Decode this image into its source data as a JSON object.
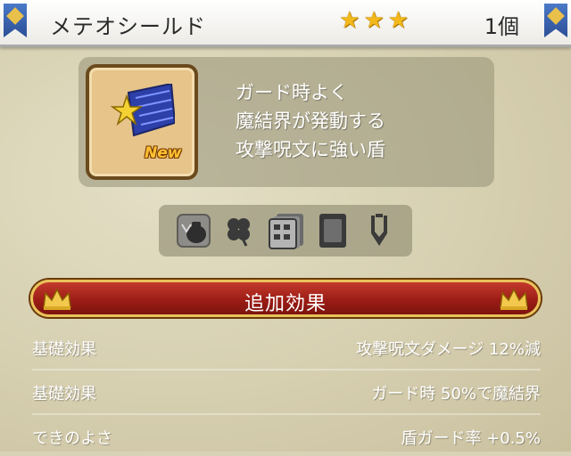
{
  "header": {
    "item_name": "メテオシールド",
    "rarity_stars": 3,
    "quantity": "1個"
  },
  "item": {
    "icon": "meteor-shield-icon",
    "new_badge": "New",
    "description": [
      "ガード時よく",
      "魔結界が発動する",
      "攻撃呪文に強い盾"
    ]
  },
  "categories": [
    "bag-icon",
    "clover-icon",
    "cards-icon",
    "card-icon",
    "gear-icon"
  ],
  "section": {
    "title": "追加効果"
  },
  "stats": [
    {
      "label": "基礎効果",
      "value": "攻撃呪文ダメージ 12%減"
    },
    {
      "label": "基礎効果",
      "value": "ガード時 50%で魔結界"
    },
    {
      "label": "できのよさ",
      "value": "盾ガード率 +0.5%"
    }
  ],
  "colors": {
    "star": "#f2b81c",
    "banner": "#9c1d16",
    "banner_border": "#e9c25a"
  }
}
